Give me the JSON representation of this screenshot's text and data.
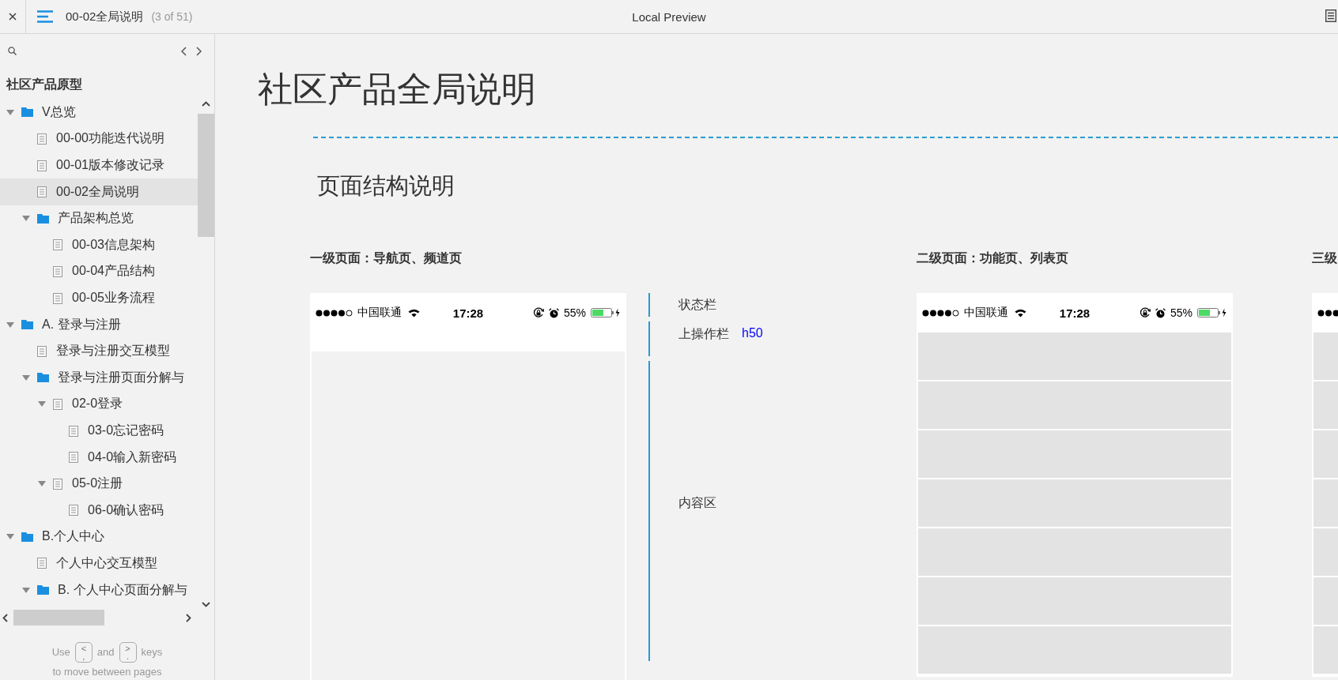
{
  "toolbar": {
    "page_title": "00-02全局说明",
    "page_count": "(3 of 51)",
    "app_title": "Local Preview"
  },
  "sidebar": {
    "project_title": "社区产品原型",
    "tree": [
      {
        "kind": "folder",
        "label": "V总览",
        "expanded": true,
        "selected": false,
        "children": [
          {
            "kind": "page",
            "label": "00-00功能迭代说明",
            "selected": false
          },
          {
            "kind": "page",
            "label": "00-01版本修改记录",
            "selected": false
          },
          {
            "kind": "page",
            "label": "00-02全局说明",
            "selected": true
          },
          {
            "kind": "folder",
            "label": "产品架构总览",
            "expanded": true,
            "selected": false,
            "children": [
              {
                "kind": "page",
                "label": "00-03信息架构",
                "selected": false
              },
              {
                "kind": "page",
                "label": "00-04产品结构",
                "selected": false
              },
              {
                "kind": "page",
                "label": "00-05业务流程",
                "selected": false
              }
            ]
          }
        ]
      },
      {
        "kind": "folder",
        "label": "A. 登录与注册",
        "expanded": true,
        "selected": false,
        "children": [
          {
            "kind": "page",
            "label": "登录与注册交互模型",
            "selected": false
          },
          {
            "kind": "folder",
            "label": "登录与注册页面分解与",
            "expanded": true,
            "selected": false,
            "children": [
              {
                "kind": "page",
                "label": "02-0登录",
                "expanded": true,
                "selected": false,
                "children": [
                  {
                    "kind": "page",
                    "label": "03-0忘记密码",
                    "selected": false
                  },
                  {
                    "kind": "page",
                    "label": "04-0输入新密码",
                    "selected": false
                  }
                ]
              },
              {
                "kind": "page",
                "label": "05-0注册",
                "expanded": true,
                "selected": false,
                "children": [
                  {
                    "kind": "page",
                    "label": "06-0确认密码",
                    "selected": false
                  }
                ]
              }
            ]
          }
        ]
      },
      {
        "kind": "folder",
        "label": "B.个人中心",
        "expanded": true,
        "selected": false,
        "children": [
          {
            "kind": "page",
            "label": "个人中心交互模型",
            "selected": false
          },
          {
            "kind": "folder",
            "label": "B. 个人中心页面分解与",
            "expanded": true,
            "selected": false
          }
        ]
      }
    ],
    "hint": {
      "use": "Use",
      "prev_key": [
        "<",
        ","
      ],
      "and": "and",
      "next_key": [
        ">",
        "."
      ],
      "keys": "keys",
      "line2": "to move between pages"
    }
  },
  "document": {
    "title": "社区产品全局说明",
    "section_title": "页面结构说明",
    "columns": [
      {
        "heading": "一级页面：导航页、频道页",
        "phone": {
          "kind": "blank",
          "carrier": "中国联通",
          "time": "17:28",
          "battery": "55%"
        },
        "annotations": [
          {
            "label": "状态栏"
          },
          {
            "label": "上操作栏",
            "value": "h50"
          },
          {
            "label": "内容区"
          }
        ]
      },
      {
        "heading": "二级页面：功能页、列表页",
        "phone": {
          "kind": "list",
          "carrier": "中国联通",
          "time": "17:28",
          "battery": "55%"
        }
      },
      {
        "heading": "三级",
        "phone": {
          "kind": "list"
        }
      }
    ]
  }
}
